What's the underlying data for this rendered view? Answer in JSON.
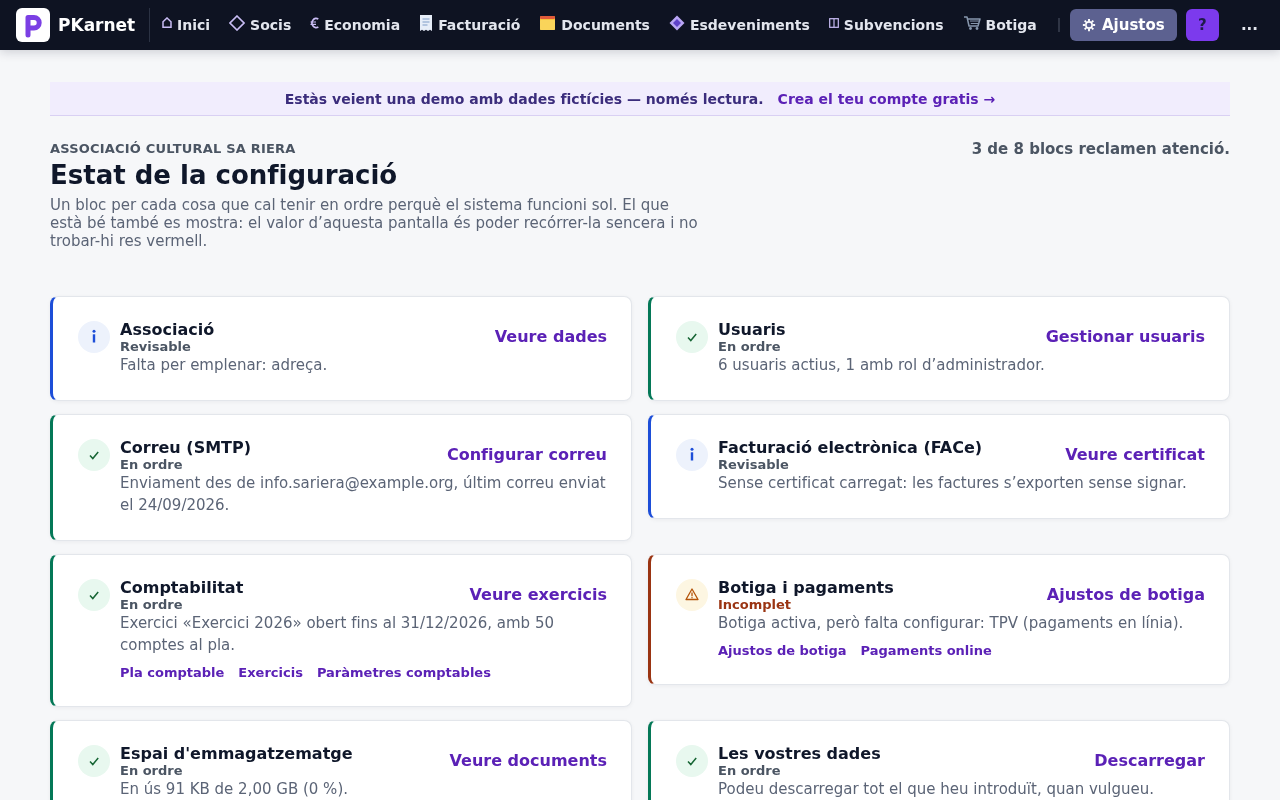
{
  "nav": {
    "brand": "PKarnet",
    "items": [
      {
        "label": "Inici",
        "selected": false
      },
      {
        "label": "Socis",
        "selected": false
      },
      {
        "label": "Economia",
        "selected": false
      },
      {
        "label": "Facturació",
        "selected": false
      },
      {
        "label": "Documents",
        "selected": false
      },
      {
        "label": "Esdeveniments",
        "selected": false
      },
      {
        "label": "Subvencions",
        "selected": false
      },
      {
        "label": "Botiga",
        "selected": false
      }
    ],
    "settings": {
      "label": "Ajustos",
      "selected": true
    },
    "help": "?",
    "more": "..."
  },
  "banner": {
    "text": "Estàs veient una demo amb dades fictícies — només lectura.",
    "link": "Crea el teu compte gratis →"
  },
  "header": {
    "eyebrow": "ASSOCIACIÓ CULTURAL SA RIERA",
    "title": "Estat de la configuració",
    "description": "Un bloc per cada cosa que cal tenir en ordre perquè el sistema funcioni sol. El que està bé també es mostra: el valor d’aquesta pantalla és poder recórrer-la sencera i no trobar-hi res vermell.",
    "summary": "3 de 8 blocs reclamen atenció."
  },
  "cards": [
    {
      "kind": "info",
      "title": "Associació",
      "status": "Revisable",
      "description": "Falta per emplenar: adreça.",
      "action": "Veure dades"
    },
    {
      "kind": "ok",
      "title": "Usuaris",
      "status": "En ordre",
      "description": "6 usuaris actius, 1 amb rol d’administrador.",
      "action": "Gestionar usuaris"
    },
    {
      "kind": "ok",
      "title": "Correu (SMTP)",
      "status": "En ordre",
      "description": "Enviament des de info.sariera@example.org, últim correu enviat el 24/09/2026.",
      "action": "Configurar correu"
    },
    {
      "kind": "info",
      "title": "Facturació electrònica (FACe)",
      "status": "Revisable",
      "description": "Sense certificat carregat: les factures s’exporten sense signar.",
      "action": "Veure certificat"
    },
    {
      "kind": "ok",
      "title": "Comptabilitat",
      "status": "En ordre",
      "description": "Exercici «Exercici 2026» obert fins al 31/12/2026, amb 50 comptes al pla.",
      "action": "Veure exercicis",
      "links": [
        "Pla comptable",
        "Exercicis",
        "Paràmetres comptables"
      ]
    },
    {
      "kind": "warning",
      "title": "Botiga i pagaments",
      "status": "Incomplet",
      "description": "Botiga activa, però falta configurar: TPV (pagaments en línia).",
      "action": "Ajustos de botiga",
      "links": [
        "Ajustos de botiga",
        "Pagaments online"
      ]
    },
    {
      "kind": "ok",
      "title": "Espai d'emmagatzematge",
      "status": "En ordre",
      "description": "En ús 91 KB de 2,00 GB (0 %).",
      "action": "Veure documents"
    },
    {
      "kind": "ok",
      "title": "Les vostres dades",
      "status": "En ordre",
      "description": "Podeu descarregar tot el que heu introduït, quan vulgueu.",
      "action": "Descarregar"
    }
  ]
}
